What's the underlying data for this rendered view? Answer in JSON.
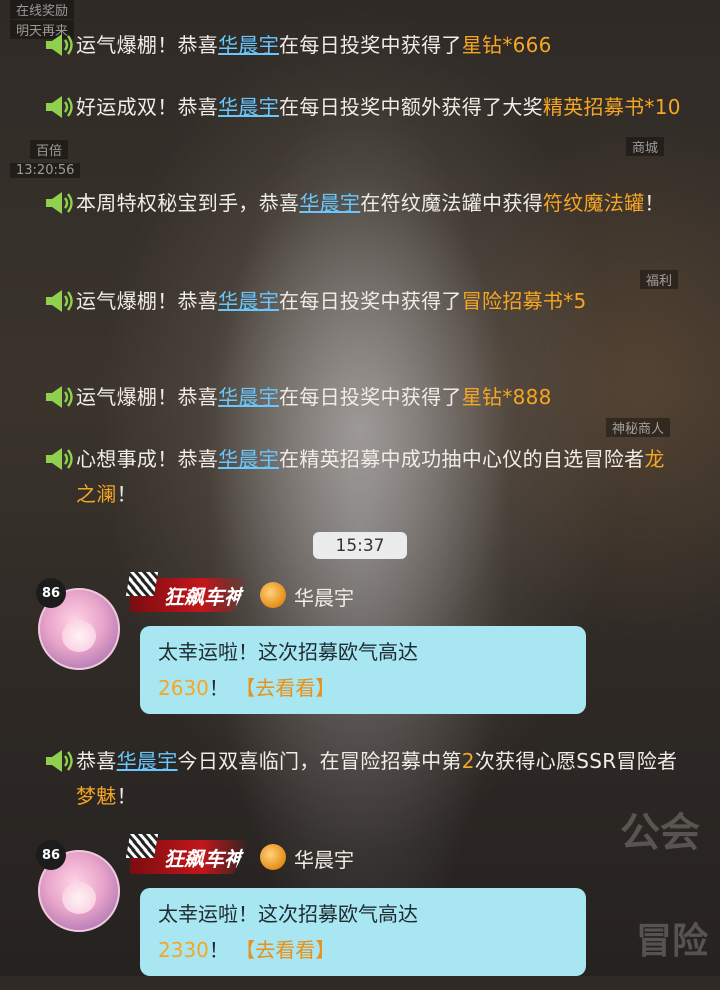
{
  "background_labels": {
    "top_left_1": "在线奖励",
    "top_left_2": "明天再来",
    "left_1": "百倍",
    "time_label": "13:20:56",
    "shop": "商城",
    "welfare": "福利",
    "mystery": "神秘商人",
    "guild": "公会",
    "adventure": "冒险"
  },
  "system_messages": [
    {
      "segments": [
        {
          "t": "运气爆棚！恭喜"
        },
        {
          "t": "华晨宇",
          "k": "name"
        },
        {
          "t": "在每日投奖中获得了"
        },
        {
          "t": "星钻*666",
          "k": "prize"
        }
      ]
    },
    {
      "segments": [
        {
          "t": "好运成双！恭喜"
        },
        {
          "t": "华晨宇",
          "k": "name"
        },
        {
          "t": "在每日投奖中额外获得了大奖"
        },
        {
          "t": "精英招募书*10",
          "k": "prize"
        }
      ]
    },
    {
      "segments": [
        {
          "t": "本周特权秘宝到手，恭喜"
        },
        {
          "t": "华晨宇",
          "k": "name"
        },
        {
          "t": "在符纹魔法罐中获得"
        },
        {
          "t": "符纹魔法罐",
          "k": "prize"
        },
        {
          "t": "！"
        }
      ]
    },
    {
      "segments": [
        {
          "t": "运气爆棚！恭喜"
        },
        {
          "t": "华晨宇",
          "k": "name"
        },
        {
          "t": "在每日投奖中获得了"
        },
        {
          "t": "冒险招募书*5",
          "k": "prize"
        }
      ]
    },
    {
      "segments": [
        {
          "t": "运气爆棚！恭喜"
        },
        {
          "t": "华晨宇",
          "k": "name"
        },
        {
          "t": "在每日投奖中获得了"
        },
        {
          "t": "星钻*888",
          "k": "prize"
        }
      ]
    },
    {
      "segments": [
        {
          "t": "心想事成！恭喜"
        },
        {
          "t": "华晨宇",
          "k": "name"
        },
        {
          "t": "在精英招募中成功抽中心仪的自选冒险者"
        },
        {
          "t": "龙之澜",
          "k": "prize"
        },
        {
          "t": "！"
        }
      ]
    },
    {
      "segments": [
        {
          "t": "恭喜"
        },
        {
          "t": "华晨宇",
          "k": "name"
        },
        {
          "t": "今日双喜临门，在冒险招募中第"
        },
        {
          "t": "2",
          "k": "num"
        },
        {
          "t": "次获得心愿SSR冒险者"
        },
        {
          "t": "梦魅",
          "k": "prize"
        },
        {
          "t": "！"
        }
      ]
    }
  ],
  "time_separator": "15:37",
  "chats": [
    {
      "level": "86",
      "title": "狂飙车神",
      "sender": "华晨宇",
      "text_line1": "太幸运啦！这次招募欧气高达",
      "value": "2630",
      "excl": "！",
      "link": "【去看看】"
    },
    {
      "level": "86",
      "title": "狂飙车神",
      "sender": "华晨宇",
      "text_line1": "太幸运啦！这次招募欧气高达",
      "value": "2330",
      "excl": "！",
      "link": "【去看看】"
    }
  ],
  "colors": {
    "name": "#69c7ff",
    "prize": "#f5a623",
    "bubble": "#a8e6f2",
    "text": "#f1ede6",
    "horn": "#8fd14f"
  }
}
